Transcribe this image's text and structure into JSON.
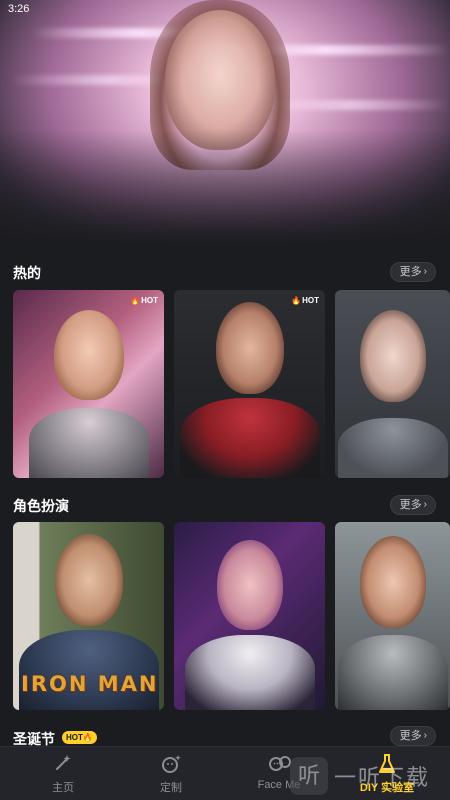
{
  "status": {
    "time": "3:26"
  },
  "sections": {
    "hot": {
      "title": "热的",
      "more": "更多"
    },
    "roleplay": {
      "title": "角色扮演",
      "more": "更多"
    },
    "christmas": {
      "title": "圣诞节",
      "more": "更多",
      "badge": "HOT"
    }
  },
  "cards": {
    "hot1": {
      "badge": "HOT"
    },
    "hot2": {
      "badge": "HOT"
    },
    "role1": {
      "overlay_text": "IRON MAN"
    }
  },
  "tabbar": {
    "home": {
      "label": "主页",
      "icon": "magic-wand-icon"
    },
    "custom": {
      "label": "定制",
      "icon": "face-sparkle-icon"
    },
    "faceme": {
      "label": "Face Me",
      "icon": "faces-icon"
    },
    "diy": {
      "label": "DIY 实验室",
      "icon": "flask-icon",
      "active": true
    }
  },
  "watermark": {
    "logo_char": "听",
    "text": "一听下载"
  },
  "colors": {
    "background": "#1b1c20",
    "accent": "#ffd02c",
    "tabbar": "#24252a",
    "inactive": "#8d8e94"
  }
}
